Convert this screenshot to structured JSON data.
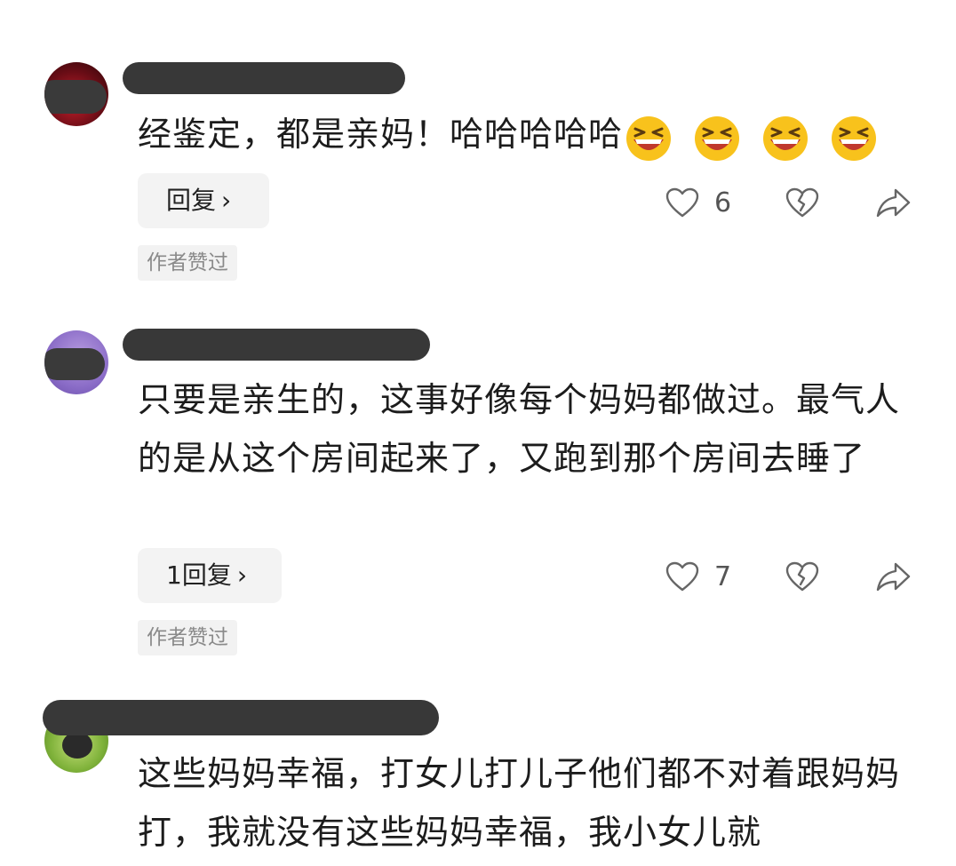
{
  "comments": [
    {
      "text": "经鉴定，都是亲妈！哈哈哈哈哈",
      "emoji_icon": "laughing-face-emoji",
      "emoji_count": 4,
      "reply_label": "回复",
      "like_count": "6",
      "author_liked_badge": "作者赞过"
    },
    {
      "text": "只要是亲生的，这事好像每个妈妈都做过。最气人的是从这个房间起来了，又跑到那个房间去睡了",
      "reply_label": "1回复",
      "like_count": "7",
      "author_liked_badge": "作者赞过"
    },
    {
      "text": "这些妈妈幸福，打女儿打儿子他们都不对着跟妈妈打，我就没有这些妈妈幸福，我小女儿就"
    }
  ],
  "icons": {
    "like": "heart-outline-icon",
    "dislike": "broken-heart-icon",
    "share": "share-arrow-icon",
    "chevron": "chevron-right-icon"
  },
  "colors": {
    "redaction": "#383838",
    "reply_bg": "#f3f3f3",
    "badge_text": "#8a8a8a",
    "icon_stroke": "#666666",
    "emoji_yellow": "#f8c21c"
  }
}
